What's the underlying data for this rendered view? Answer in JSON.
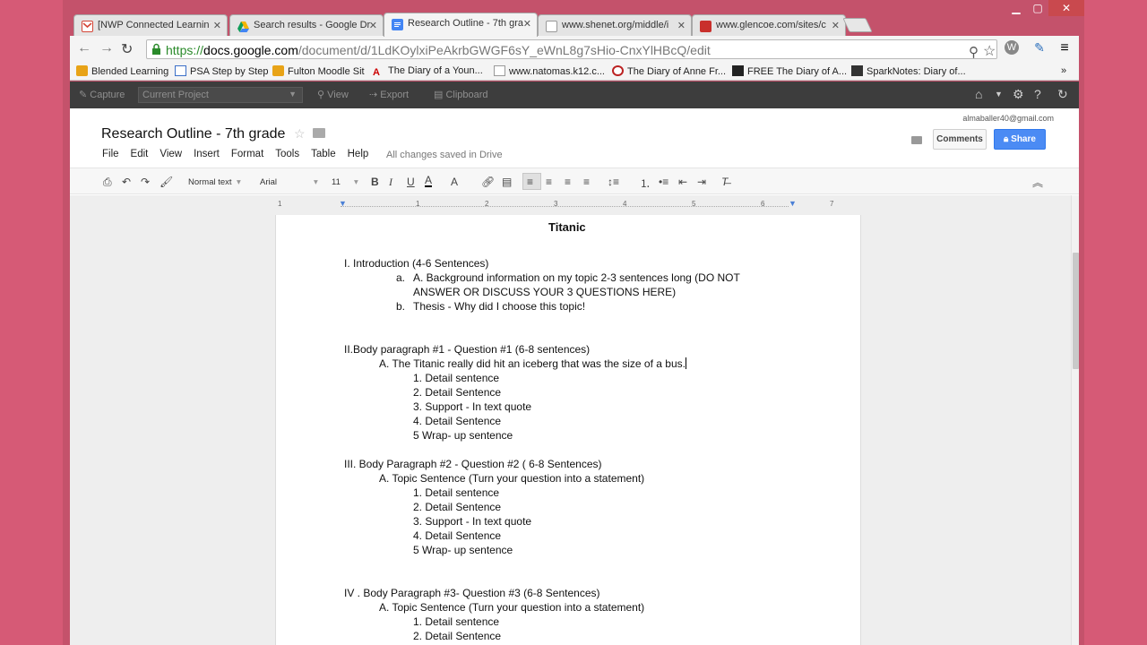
{
  "browser": {
    "tabs": [
      {
        "title": "[NWP Connected Learnin",
        "icon": "gmail-icon",
        "color": "#d44638"
      },
      {
        "title": "Search results - Google Dr",
        "icon": "drive-icon",
        "color": "#f4b400"
      },
      {
        "title": "Research Outline - 7th gra",
        "icon": "docs-icon",
        "color": "#4285f4"
      },
      {
        "title": "www.shenet.org/middle/i",
        "icon": "page-icon",
        "color": "#ffffff"
      },
      {
        "title": "www.glencoe.com/sites/c",
        "icon": "glencoe-icon",
        "color": "#c9302c"
      }
    ],
    "url": {
      "scheme": "https://",
      "host": "docs.google.com",
      "path": "/document/d/1LdKOylxiPeAkrbGWGF6sY_eWnL8g7sHio-CnxYlHBcQ/edit"
    },
    "bookmarks": [
      {
        "label": "Blended Learning",
        "icon": "moodle-icon"
      },
      {
        "label": "PSA Step by Step",
        "icon": "doc-icon"
      },
      {
        "label": "Fulton Moodle Sit",
        "icon": "moodle-icon"
      },
      {
        "label": "The Diary of a Youn...",
        "icon": "pdf-icon"
      },
      {
        "label": "www.natomas.k12.c...",
        "icon": "page-icon"
      },
      {
        "label": "The Diary of Anne Fr...",
        "icon": "circle-icon"
      },
      {
        "label": "FREE The Diary of A...",
        "icon": "book-icon"
      },
      {
        "label": "SparkNotes: Diary of...",
        "icon": "spark-icon"
      }
    ],
    "bookmarks_more": "»"
  },
  "extension_bar": {
    "capture": "Capture",
    "project": "Current Project",
    "view": "View",
    "export": "Export",
    "clipboard": "Clipboard"
  },
  "docs": {
    "user_email": "almaballer40@gmail.com",
    "title": "Research Outline - 7th grade",
    "menu": [
      "File",
      "Edit",
      "View",
      "Insert",
      "Format",
      "Tools",
      "Table",
      "Help"
    ],
    "saved_status": "All changes saved in Drive",
    "comments_label": "Comments",
    "share_label": "Share",
    "toolbar": {
      "style": "Normal text",
      "font": "Arial",
      "size": "11"
    },
    "ruler_numbers": [
      "1",
      "1",
      "2",
      "3",
      "4",
      "5",
      "6",
      "7"
    ]
  },
  "document": {
    "heading": "Titanic",
    "lines": [
      "I. Introduction (4-6 Sentences)",
      "a.",
      "A. Background information on my topic 2-3 sentences long (DO NOT",
      "ANSWER OR DISCUSS YOUR 3 QUESTIONS HERE)",
      "b.",
      "Thesis - Why did I choose this topic!",
      "II.Body paragraph #1 - Question #1  (6-8 sentences)",
      "A. The Titanic really did hit an iceberg that was the size of a bus.",
      "1. Detail sentence",
      "2. Detail Sentence",
      "3. Support - In text quote",
      "4. Detail Sentence",
      "5 Wrap- up sentence",
      "III. Body Paragraph #2 - Question #2 ( 6-8 Sentences)",
      "A. Topic Sentence (Turn your question into a statement)",
      "1. Detail sentence",
      "2. Detail Sentence",
      "3. Support - In text quote",
      "4. Detail Sentence",
      "5 Wrap- up sentence",
      "IV . Body Paragraph #3- Question #3  (6-8 Sentences)",
      "A. Topic Sentence (Turn your question into a statement)",
      "1. Detail sentence",
      "2. Detail Sentence"
    ]
  }
}
